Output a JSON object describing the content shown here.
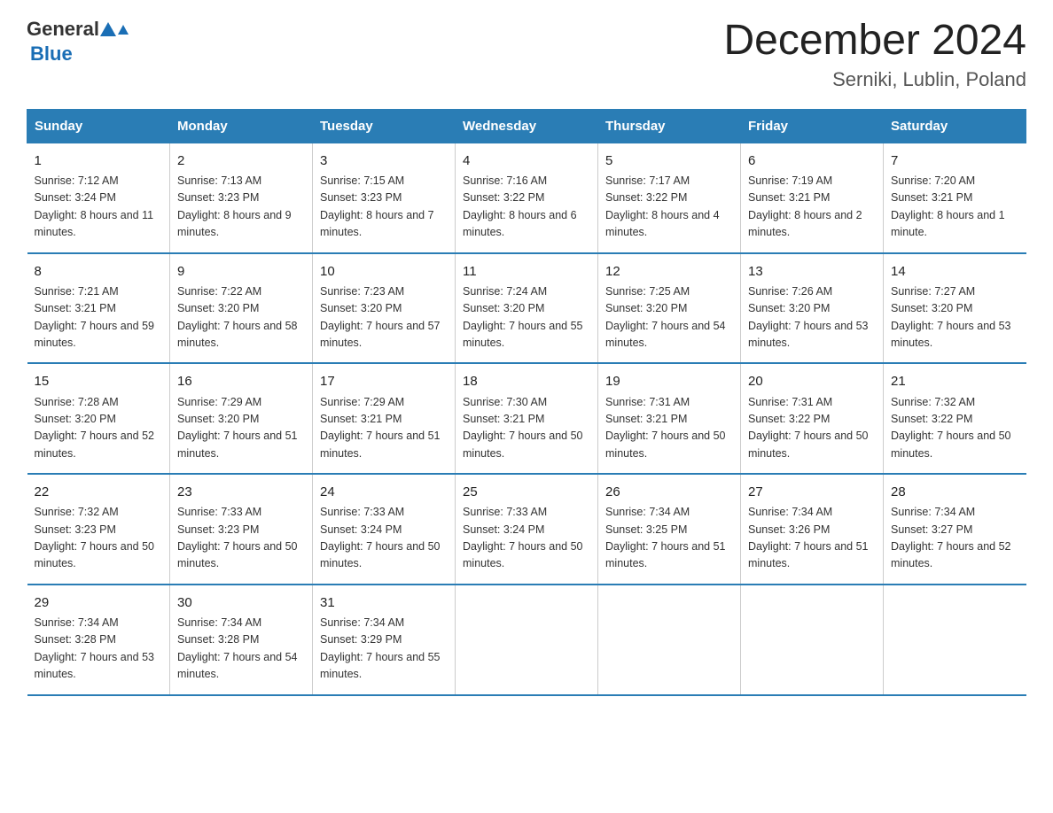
{
  "header": {
    "logo_general": "General",
    "logo_blue": "Blue",
    "month_year": "December 2024",
    "location": "Serniki, Lublin, Poland"
  },
  "days_of_week": [
    "Sunday",
    "Monday",
    "Tuesday",
    "Wednesday",
    "Thursday",
    "Friday",
    "Saturday"
  ],
  "weeks": [
    [
      {
        "day": "1",
        "sunrise": "7:12 AM",
        "sunset": "3:24 PM",
        "daylight": "8 hours and 11 minutes."
      },
      {
        "day": "2",
        "sunrise": "7:13 AM",
        "sunset": "3:23 PM",
        "daylight": "8 hours and 9 minutes."
      },
      {
        "day": "3",
        "sunrise": "7:15 AM",
        "sunset": "3:23 PM",
        "daylight": "8 hours and 7 minutes."
      },
      {
        "day": "4",
        "sunrise": "7:16 AM",
        "sunset": "3:22 PM",
        "daylight": "8 hours and 6 minutes."
      },
      {
        "day": "5",
        "sunrise": "7:17 AM",
        "sunset": "3:22 PM",
        "daylight": "8 hours and 4 minutes."
      },
      {
        "day": "6",
        "sunrise": "7:19 AM",
        "sunset": "3:21 PM",
        "daylight": "8 hours and 2 minutes."
      },
      {
        "day": "7",
        "sunrise": "7:20 AM",
        "sunset": "3:21 PM",
        "daylight": "8 hours and 1 minute."
      }
    ],
    [
      {
        "day": "8",
        "sunrise": "7:21 AM",
        "sunset": "3:21 PM",
        "daylight": "7 hours and 59 minutes."
      },
      {
        "day": "9",
        "sunrise": "7:22 AM",
        "sunset": "3:20 PM",
        "daylight": "7 hours and 58 minutes."
      },
      {
        "day": "10",
        "sunrise": "7:23 AM",
        "sunset": "3:20 PM",
        "daylight": "7 hours and 57 minutes."
      },
      {
        "day": "11",
        "sunrise": "7:24 AM",
        "sunset": "3:20 PM",
        "daylight": "7 hours and 55 minutes."
      },
      {
        "day": "12",
        "sunrise": "7:25 AM",
        "sunset": "3:20 PM",
        "daylight": "7 hours and 54 minutes."
      },
      {
        "day": "13",
        "sunrise": "7:26 AM",
        "sunset": "3:20 PM",
        "daylight": "7 hours and 53 minutes."
      },
      {
        "day": "14",
        "sunrise": "7:27 AM",
        "sunset": "3:20 PM",
        "daylight": "7 hours and 53 minutes."
      }
    ],
    [
      {
        "day": "15",
        "sunrise": "7:28 AM",
        "sunset": "3:20 PM",
        "daylight": "7 hours and 52 minutes."
      },
      {
        "day": "16",
        "sunrise": "7:29 AM",
        "sunset": "3:20 PM",
        "daylight": "7 hours and 51 minutes."
      },
      {
        "day": "17",
        "sunrise": "7:29 AM",
        "sunset": "3:21 PM",
        "daylight": "7 hours and 51 minutes."
      },
      {
        "day": "18",
        "sunrise": "7:30 AM",
        "sunset": "3:21 PM",
        "daylight": "7 hours and 50 minutes."
      },
      {
        "day": "19",
        "sunrise": "7:31 AM",
        "sunset": "3:21 PM",
        "daylight": "7 hours and 50 minutes."
      },
      {
        "day": "20",
        "sunrise": "7:31 AM",
        "sunset": "3:22 PM",
        "daylight": "7 hours and 50 minutes."
      },
      {
        "day": "21",
        "sunrise": "7:32 AM",
        "sunset": "3:22 PM",
        "daylight": "7 hours and 50 minutes."
      }
    ],
    [
      {
        "day": "22",
        "sunrise": "7:32 AM",
        "sunset": "3:23 PM",
        "daylight": "7 hours and 50 minutes."
      },
      {
        "day": "23",
        "sunrise": "7:33 AM",
        "sunset": "3:23 PM",
        "daylight": "7 hours and 50 minutes."
      },
      {
        "day": "24",
        "sunrise": "7:33 AM",
        "sunset": "3:24 PM",
        "daylight": "7 hours and 50 minutes."
      },
      {
        "day": "25",
        "sunrise": "7:33 AM",
        "sunset": "3:24 PM",
        "daylight": "7 hours and 50 minutes."
      },
      {
        "day": "26",
        "sunrise": "7:34 AM",
        "sunset": "3:25 PM",
        "daylight": "7 hours and 51 minutes."
      },
      {
        "day": "27",
        "sunrise": "7:34 AM",
        "sunset": "3:26 PM",
        "daylight": "7 hours and 51 minutes."
      },
      {
        "day": "28",
        "sunrise": "7:34 AM",
        "sunset": "3:27 PM",
        "daylight": "7 hours and 52 minutes."
      }
    ],
    [
      {
        "day": "29",
        "sunrise": "7:34 AM",
        "sunset": "3:28 PM",
        "daylight": "7 hours and 53 minutes."
      },
      {
        "day": "30",
        "sunrise": "7:34 AM",
        "sunset": "3:28 PM",
        "daylight": "7 hours and 54 minutes."
      },
      {
        "day": "31",
        "sunrise": "7:34 AM",
        "sunset": "3:29 PM",
        "daylight": "7 hours and 55 minutes."
      },
      null,
      null,
      null,
      null
    ]
  ],
  "labels": {
    "sunrise": "Sunrise:",
    "sunset": "Sunset:",
    "daylight": "Daylight:"
  }
}
